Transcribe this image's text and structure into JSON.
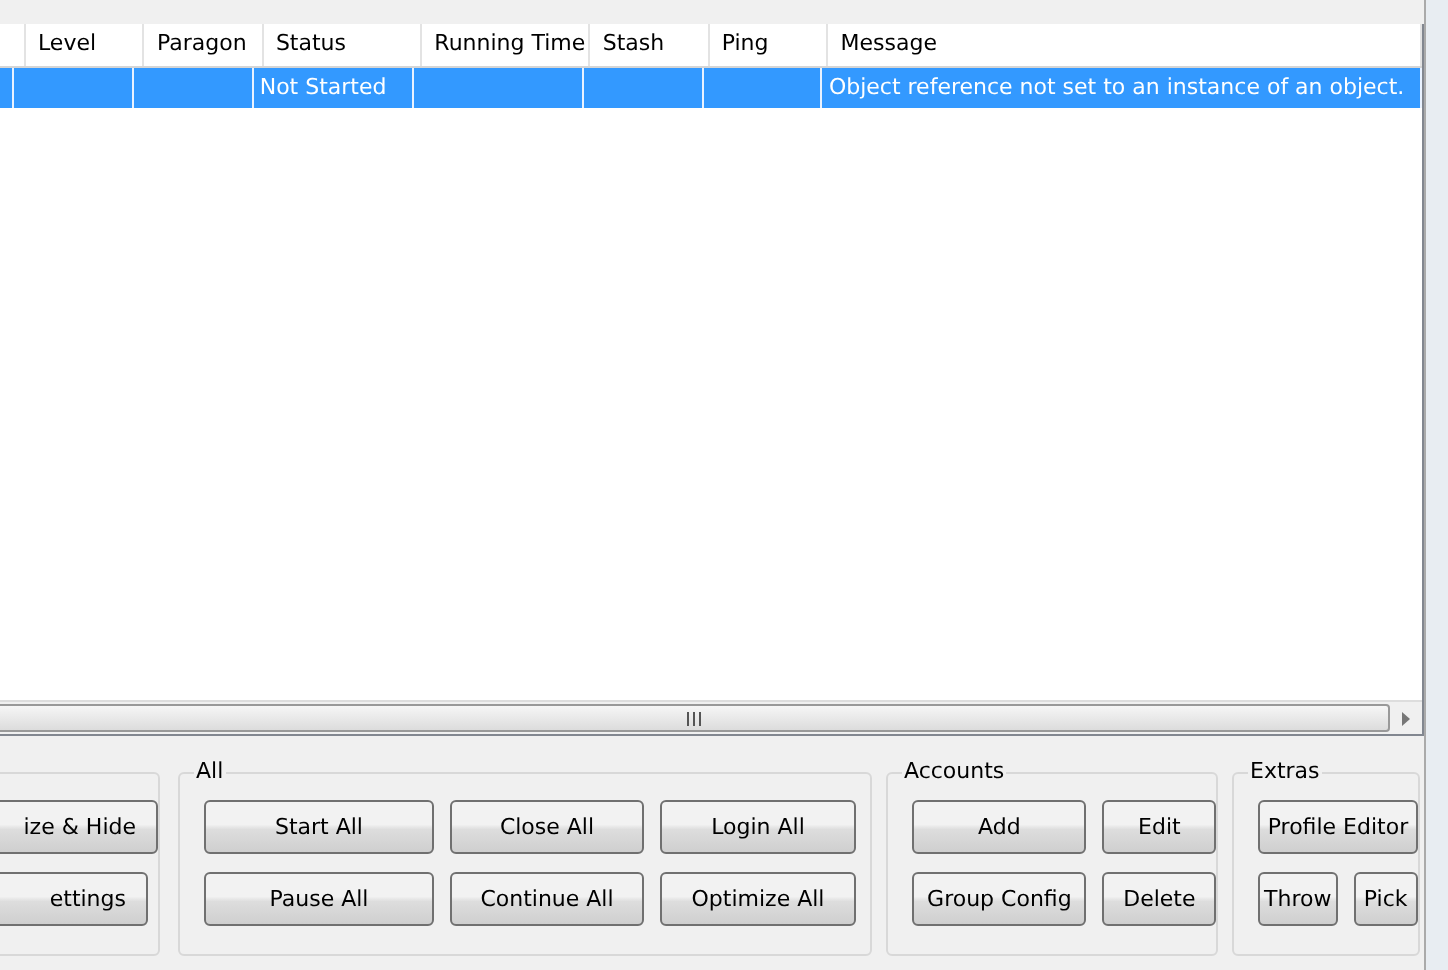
{
  "table": {
    "columns": [
      "",
      "Level",
      "Paragon",
      "Status",
      "Running Time",
      "Stash",
      "Ping",
      "Message"
    ],
    "rows": [
      {
        "selected": true,
        "cells": [
          null,
          null,
          null,
          "Not Started",
          null,
          null,
          null,
          "Object reference not set to an instance of an object."
        ]
      }
    ]
  },
  "groups": [
    {
      "rows": [
        [
          "ize & Hide"
        ],
        [
          "ettings"
        ]
      ]
    },
    {
      "title": "All",
      "rows": [
        [
          "Start All",
          "Close All",
          "Login All"
        ],
        [
          "Pause All",
          "Continue All",
          "Optimize All"
        ]
      ]
    },
    {
      "title": "Accounts",
      "rows": [
        [
          "Add",
          "Edit"
        ],
        [
          "Group Config",
          "Delete"
        ]
      ]
    },
    {
      "title": "Extras",
      "rows": [
        [
          "Profile Editor"
        ],
        [
          "Throw",
          "Pick"
        ]
      ]
    }
  ]
}
